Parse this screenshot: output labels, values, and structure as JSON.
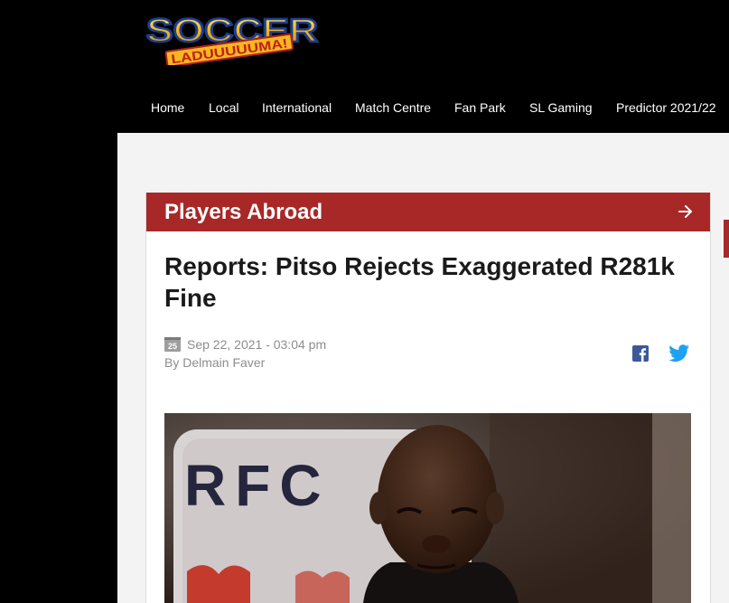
{
  "logo": {
    "top_text": "SOCCER",
    "banner_text": "LADUUUUUMA!"
  },
  "nav": [
    {
      "label": "Home"
    },
    {
      "label": "Local"
    },
    {
      "label": "International"
    },
    {
      "label": "Match Centre"
    },
    {
      "label": "Fan Park"
    },
    {
      "label": "SL Gaming"
    },
    {
      "label": "Predictor 2021/22"
    }
  ],
  "section": {
    "title": "Players Abroad"
  },
  "article": {
    "headline": "Reports: Pitso Rejects Exaggerated R281k Fine",
    "date_icon": "25",
    "date": "Sep 22, 2021 - 03:04 pm",
    "author": "By Delmain Faver"
  },
  "photo": {
    "sign_text": "RFC"
  },
  "colors": {
    "accent": "#a82828",
    "facebook": "#3b5998",
    "twitter": "#1da1f2",
    "background": "#000000",
    "page": "#f3f3f3"
  }
}
